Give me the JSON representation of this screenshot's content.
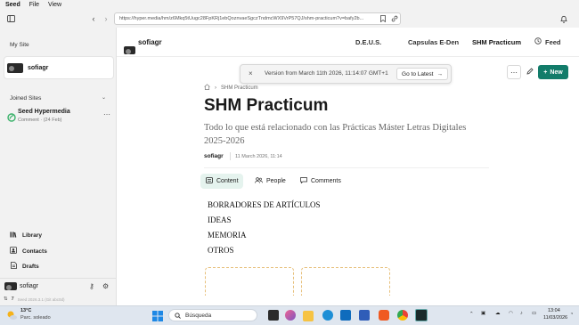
{
  "menubar": {
    "items": [
      "Seed",
      "File",
      "View"
    ]
  },
  "toolbar": {
    "url": "https://hyper.media/hm/z6Mkq5tUugc28FpKRj1ebQoznvaeSgczTndmcWX9VrP57QJ/shm-practicum?v=bafy2b..."
  },
  "sidebar": {
    "my_site_label": "My Site",
    "site_name": "sofiagr",
    "joined_label": "Joined Sites",
    "joined_item": {
      "title": "Seed Hypermedia",
      "meta": "Comment · (24 Feb)"
    },
    "nav": [
      {
        "label": "Library",
        "icon": "library-icon"
      },
      {
        "label": "Contacts",
        "icon": "contacts-icon"
      },
      {
        "label": "Drafts",
        "icon": "drafts-icon"
      }
    ],
    "footer_user": "sofiagr"
  },
  "header": {
    "site_name": "sofiagr",
    "links": [
      "D.E.U.S.",
      "Capsulas E-Den",
      "SHM Practicum"
    ],
    "feed_label": "Feed"
  },
  "banner": {
    "text": "Version from March 11th 2026, 11:14:07 GMT+1",
    "button": "Go to Latest"
  },
  "actions": {
    "new_label": "New"
  },
  "document": {
    "breadcrumb": "SHM Practicum",
    "title": "SHM Practicum",
    "subtitle": "Todo lo que está relacionado con las Prácticas Máster Letras Digitales 2025-2026",
    "author": "sofiagr",
    "date": "11 March 2026, 11:14",
    "tabs": [
      "Content",
      "People",
      "Comments"
    ],
    "lines": [
      "BORRADORES DE ARTÍCULOS",
      "IDEAS",
      "MEMORIA",
      "OTROS"
    ]
  },
  "statusbar": {
    "count": "7",
    "version": "Seed 2026.3.1 (Git abc0d)"
  },
  "taskbar": {
    "weather_temp": "13°C",
    "weather_desc": "Parc. soleado",
    "search_placeholder": "Búsqueda",
    "time": "13:04",
    "date": "11/03/2026"
  },
  "colors": {
    "accent": "#127c6a",
    "banner_bg": "#f4f4f4",
    "dashed": "#e7c07c"
  }
}
